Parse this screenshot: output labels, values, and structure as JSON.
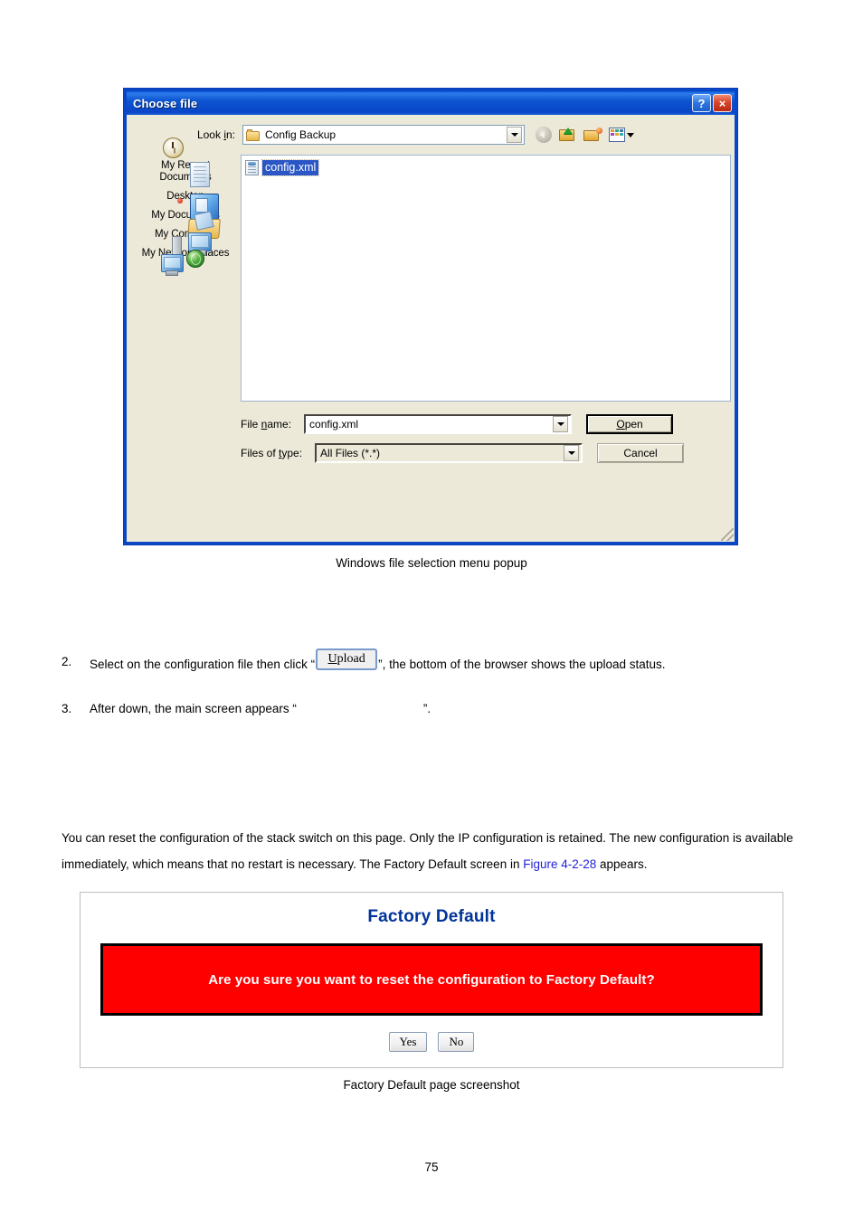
{
  "file_dialog": {
    "title": "Choose file",
    "help_button": "?",
    "close_button": "×",
    "lookin_label": "Look in:",
    "lookin_value": "Config Backup",
    "toolbar": [
      {
        "name": "back-icon",
        "label": "Back"
      },
      {
        "name": "up-one-level-icon",
        "label": "Up One Level"
      },
      {
        "name": "create-new-folder-icon",
        "label": "Create New Folder"
      },
      {
        "name": "views-icon",
        "label": "Views"
      }
    ],
    "places": [
      {
        "label": "My Recent Documents",
        "icon": "recent-documents-icon"
      },
      {
        "label": "Desktop",
        "icon": "desktop-icon"
      },
      {
        "label": "My Documents",
        "icon": "my-documents-icon"
      },
      {
        "label": "My Computer",
        "icon": "my-computer-icon"
      },
      {
        "label": "My Network Places",
        "icon": "my-network-places-icon"
      }
    ],
    "files": [
      {
        "name": "config.xml",
        "selected": true
      }
    ],
    "filename_label": "File name:",
    "filename_value": "config.xml",
    "filetype_label": "Files of type:",
    "filetype_value": "All Files (*.*)",
    "open_button": "Open",
    "cancel_button": "Cancel"
  },
  "captions": {
    "figure1": "Windows file selection menu popup",
    "figure2": "Factory Default page screenshot"
  },
  "steps": [
    {
      "number": "2.",
      "text_before": "Select on the configuration file then click “",
      "button_label": "Upload",
      "text_after": "”, the bottom of the browser shows the upload status."
    },
    {
      "number": "3.",
      "text_before": "After down, the main screen appears “",
      "button_label": "",
      "text_after": "”."
    }
  ],
  "paragraph": {
    "part1": "You can reset the configuration of the stack switch on this page. Only the IP configuration is retained. The new configuration is available immediately, which means that no restart is necessary. The Factory Default screen in ",
    "link": "Figure 4-2-28",
    "part2": " appears."
  },
  "factory_default": {
    "title": "Factory Default",
    "alert_text": "Are you sure you want to reset the configuration to Factory Default?",
    "yes_button": "Yes",
    "no_button": "No",
    "title_color": "#00339A",
    "alert_bg": "#FF0000"
  },
  "page_number": "75"
}
